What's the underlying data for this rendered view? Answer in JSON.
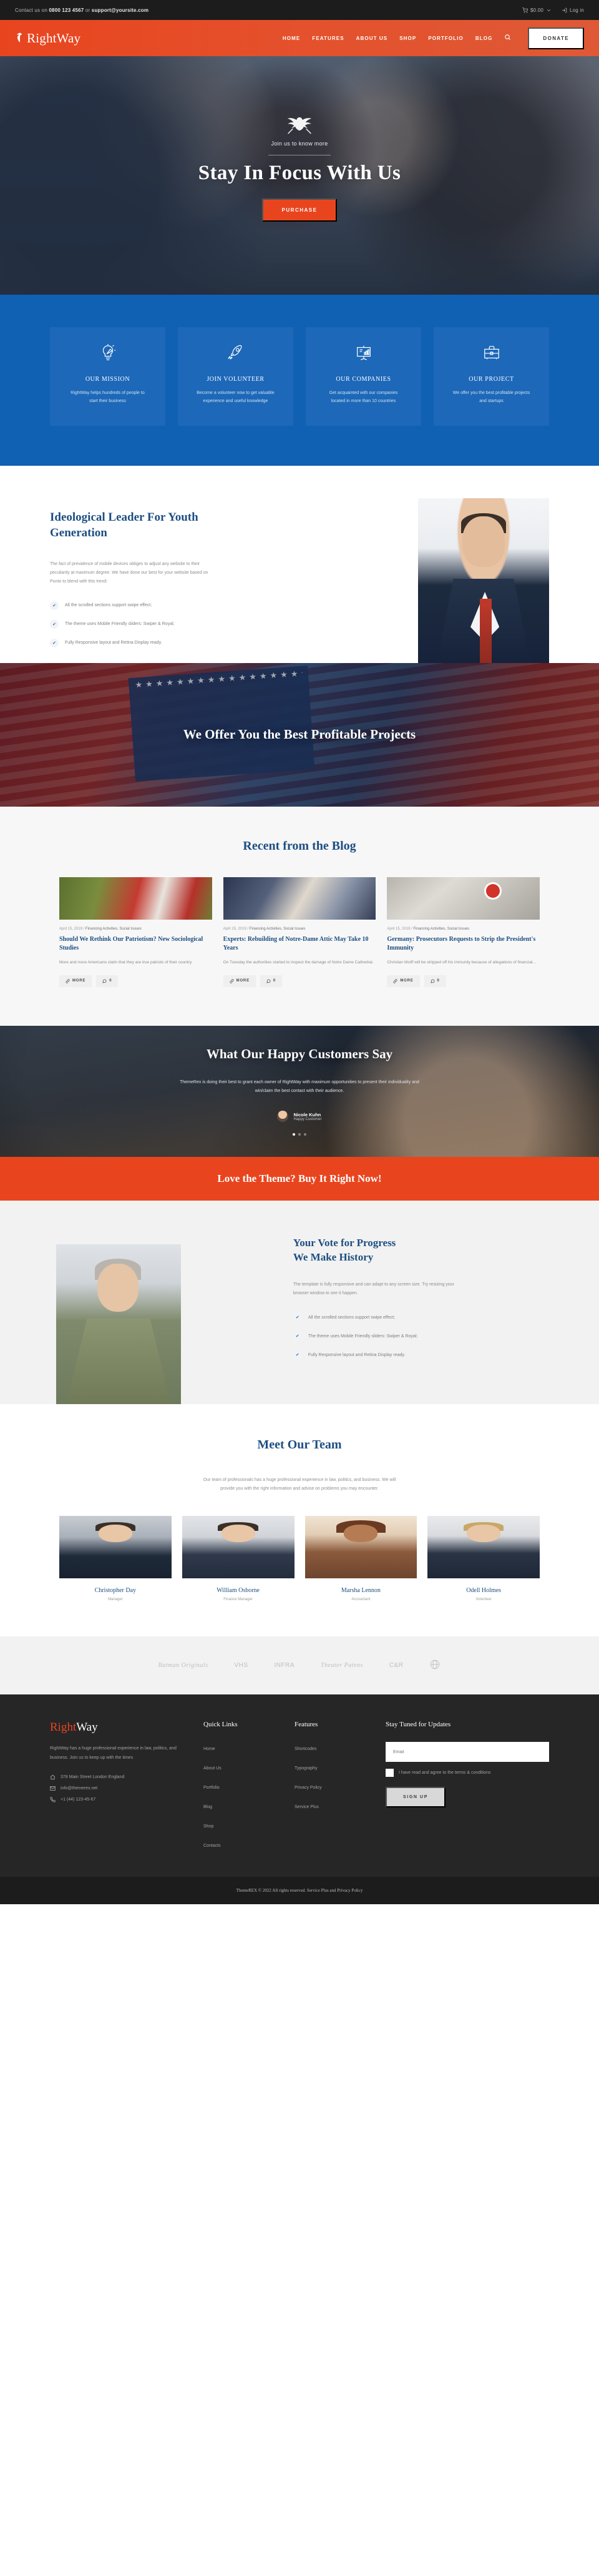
{
  "topbar": {
    "contact_prefix": "Contact us on",
    "phone": "0800 123 4567",
    "contact_join": "or",
    "email": "support@yoursite.com",
    "cart_icon": "cart-icon",
    "cart_total": "$0.00",
    "cart_caret": "chevron-down-icon",
    "login_icon": "login-icon",
    "login_label": "Log in"
  },
  "header": {
    "logo_mark": "eagle-icon",
    "logo_text": "RightWay",
    "nav": [
      {
        "label": "HOME"
      },
      {
        "label": "FEATURES"
      },
      {
        "label": "ABOUT US"
      },
      {
        "label": "SHOP"
      },
      {
        "label": "PORTFOLIO"
      },
      {
        "label": "BLOG"
      }
    ],
    "search_icon": "search-icon",
    "donate_label": "DONATE"
  },
  "hero": {
    "emblem": "eagle-emblem-icon",
    "subtitle": "Join us to know more",
    "title": "Stay In Focus With Us",
    "cta_label": "PURCHASE"
  },
  "features": {
    "cards": [
      {
        "icon": "lightbulb-icon",
        "title": "OUR MISSION",
        "text": "RightWay helps hundreds of people to start their business"
      },
      {
        "icon": "rocket-icon",
        "title": "JOIN VOLUNTEER",
        "text": "Become a volunteer now to get valuable experience and useful knowledge"
      },
      {
        "icon": "presentation-chart-icon",
        "title": "OUR COMPANIES",
        "text": "Get acquainted with our companies located in more than 10 countries"
      },
      {
        "icon": "briefcase-icon",
        "title": "OUR PROJECT",
        "text": "We offer you the best profitable projects and startups"
      }
    ]
  },
  "ideological": {
    "heading": "Ideological Leader For Youth Generation",
    "paragraph": "The fact of prevalence of mobile devices obliges to adjust any website to their peculiarity at maximum degree. We have done our best for your website based on Punto to blend with this trend:",
    "list": [
      "All the scrolled sections support swipe effect;",
      "The theme uses Mobile Friendly sliders: Swiper & Royal;",
      "Fully Responsive layout and Retina Display ready."
    ]
  },
  "flag_banner": {
    "heading": "We Offer You the Best Profitable Projects"
  },
  "blog": {
    "section_title": "Recent from the Blog",
    "posts": [
      {
        "date": "April 15, 2019",
        "separator": "/",
        "categories": "Financing Activities, Social Issues",
        "title": "Should We Rethink Our Patriotism? New Sociological Studies",
        "excerpt": "More and more Americans claim that they are true patriots of their country.",
        "more_label": "MORE",
        "more_icon": "link-icon",
        "comments_icon": "comment-icon",
        "comments": "0"
      },
      {
        "date": "April 15, 2019",
        "separator": "/",
        "categories": "Financing Activities, Social Issues",
        "title": "Experts: Rebuilding of Notre-Dame Attic May Take 10 Years",
        "excerpt": "On Tuesday the authorities started to inspect the damage of Notre Dame Cathedral.",
        "more_label": "MORE",
        "more_icon": "link-icon",
        "comments_icon": "comment-icon",
        "comments": "0"
      },
      {
        "date": "April 15, 2019",
        "separator": "/",
        "categories": "Financing Activities, Social Issues",
        "title": "Germany: Prosecutors Requests to Strip the President's Immunity",
        "excerpt": "Christian Wulff will be stripped off his immunity because of allegations of financial...",
        "more_label": "MORE",
        "more_icon": "link-icon",
        "comments_icon": "comment-icon",
        "comments": "0"
      }
    ]
  },
  "testimonial": {
    "heading": "What Our Happy Customers Say",
    "quote": "ThemeRex is doing their best to grant each owner of RightWay with maximum opportunities to present their individuality and win/claim the best contact with their audience.",
    "author_name": "Nicole Kuhn",
    "author_role": "Happy Customer"
  },
  "cta_band": {
    "heading": "Love the Theme? Buy It Right Now!"
  },
  "vote": {
    "heading_line1": "Your Vote for Progress",
    "heading_line2": "We Make History",
    "paragraph": "The template is fully responsive and can adapt to any screen size. Try resizing your browser window to see it happen.",
    "list": [
      "All the scrolled sections support swipe effect;",
      "The theme uses Mobile Friendly sliders: Swiper & Royal;",
      "Fully Responsive layout and Retina Display ready."
    ]
  },
  "team": {
    "section_title": "Meet Our Team",
    "lead": "Our team of professionals has a huge professional experience in law, politics, and business. We will provide you with the right information and advise on problems you may encounter.",
    "members": [
      {
        "name": "Christopher Day",
        "role": "Manager"
      },
      {
        "name": "William Osborne",
        "role": "Finance Manager"
      },
      {
        "name": "Marsha Lennon",
        "role": "Accountant"
      },
      {
        "name": "Odell Holmes",
        "role": "Volunteer"
      }
    ]
  },
  "clients": [
    {
      "name": "Batman Originals"
    },
    {
      "name": "VHS"
    },
    {
      "name": "INFRA"
    },
    {
      "name": "Theater Patens"
    },
    {
      "name": "C&R"
    },
    {
      "name": "globe-logo"
    }
  ],
  "footer": {
    "logo_first": "Right",
    "logo_second": "Way",
    "about": "RightWay has a huge professional experience in law, politics, and business. Join us to keep up with the times",
    "contacts": [
      {
        "icon": "home-icon",
        "text": "378 Main Street London England"
      },
      {
        "icon": "mail-icon",
        "text": "info@themerex.net"
      },
      {
        "icon": "phone-icon",
        "text": "+1 (44) 123-45-67"
      }
    ],
    "quick_links_title": "Quick Links",
    "quick_links": [
      {
        "label": "Home"
      },
      {
        "label": "About Us"
      },
      {
        "label": "Portfolio"
      },
      {
        "label": "Blog"
      },
      {
        "label": "Shop"
      },
      {
        "label": "Contacts"
      }
    ],
    "features_title": "Features",
    "features_links": [
      {
        "label": "Shortcodes"
      },
      {
        "label": "Typography"
      },
      {
        "label": "Privacy Policy"
      },
      {
        "label": "Service Plus"
      }
    ],
    "newsletter_title": "Stay Tuned for Updates",
    "email_placeholder": "Email",
    "email_value": "",
    "terms_label": "I have read and agree to the terms & conditions",
    "signup_label": "SIGN UP",
    "copyright": "ThemeREX © 2022 All rights reserved. Service Plus and Privacy Policy"
  },
  "colors": {
    "accent_red": "#e8451f",
    "accent_blue": "#1060b4",
    "heading_blue": "#1d4e82",
    "dark": "#262626"
  }
}
